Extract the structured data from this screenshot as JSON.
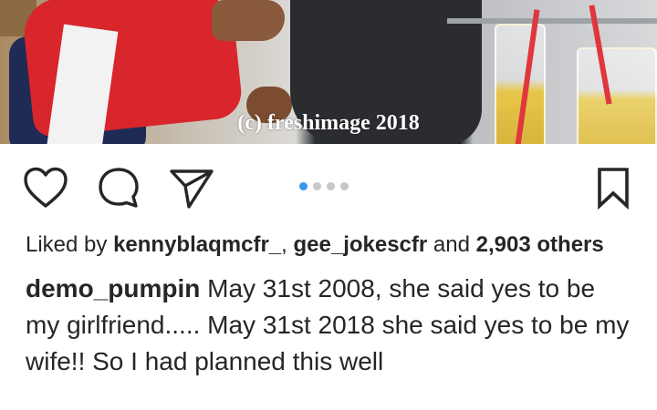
{
  "photo": {
    "watermark": "(c) freshimage 2018"
  },
  "actions": {
    "like_icon": "heart-icon",
    "comment_icon": "comment-icon",
    "share_icon": "send-icon",
    "save_icon": "bookmark-icon",
    "carousel": {
      "count": 4,
      "active_index": 0,
      "active_color": "#3897f0",
      "inactive_color": "#c7c7c7"
    }
  },
  "likes": {
    "prefix": "Liked by",
    "user1": "kennyblaqmcfr_",
    "separator": ",",
    "user2": "gee_jokescfr",
    "conjunction": "and",
    "count": "2,903",
    "suffix": "others"
  },
  "caption": {
    "username": "demo_pumpin",
    "text": "May 31st 2008, she said yes to be my girlfriend..... May 31st 2018 she said yes to be my wife!! So I had planned this well"
  }
}
